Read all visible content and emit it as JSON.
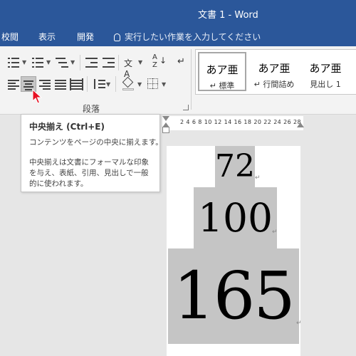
{
  "window": {
    "title": "文書 1  -  Word"
  },
  "menu": {
    "tabs": [
      "校閲",
      "表示",
      "開発"
    ],
    "tell_me": "実行したい作業を入力してください"
  },
  "ribbon": {
    "paragraph_group_label": "段落",
    "styles": [
      {
        "sample": "あア亜",
        "name": "↵ 標準",
        "selected": true
      },
      {
        "sample": "あア亜",
        "name": "↵ 行間詰め",
        "selected": false
      },
      {
        "sample": "あア亜",
        "name": "見出し 1",
        "selected": false
      }
    ]
  },
  "tooltip": {
    "title": "中央揃え (Ctrl+E)",
    "lines": [
      "コンテンツをページの中央に揃えます。",
      "",
      "中央揃えは文書にフォーマルな印象",
      "を与え、表紙、引用、見出しで一般",
      "的に使われます。"
    ]
  },
  "ruler": {
    "numbers": "2 4 6 8 10 12 14 16 18 20 22 24 26 28"
  },
  "document": {
    "paragraphs": [
      {
        "text": "72"
      },
      {
        "text": "100"
      },
      {
        "text": "165"
      }
    ],
    "paragraph_mark": "↵"
  }
}
